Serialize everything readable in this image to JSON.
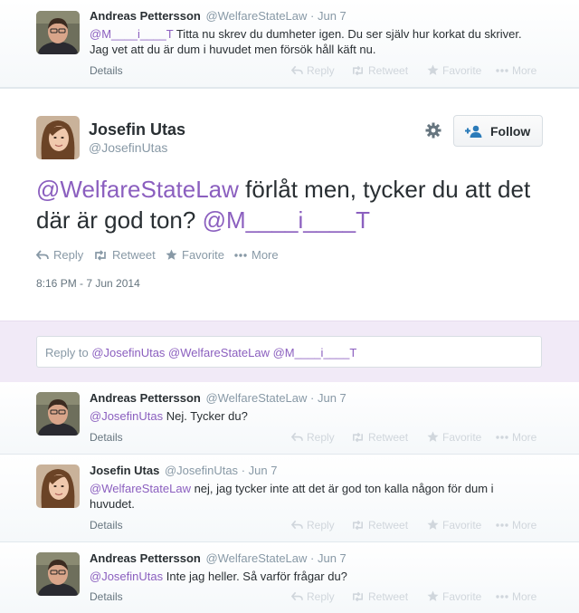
{
  "colors": {
    "mention": "#8b5fbf",
    "accent": "#2b7bb9",
    "muted": "#8899a6"
  },
  "top_tweet": {
    "name": "Andreas Pettersson",
    "handle": "@WelfareStateLaw",
    "date": "· Jun 7",
    "mention": "@M____i____T",
    "text": " Titta nu skrev du dumheter igen. Du ser själv hur korkat du skriver. Jag vet att du är dum i huvudet men försök håll käft nu.",
    "details": "Details"
  },
  "actions": {
    "reply": "Reply",
    "retweet": "Retweet",
    "favorite": "Favorite",
    "more": "More"
  },
  "main_tweet": {
    "name": "Josefin Utas",
    "handle": "@JosefinUtas",
    "follow_label": "Follow",
    "mention1": "@WelfareStateLaw",
    "text": " förlåt men, tycker du att det där är god ton? ",
    "mention2": "@M____i____T",
    "timestamp": "8:16 PM - 7 Jun 2014"
  },
  "reply_box": {
    "prefix": "Reply to ",
    "mentions": "@JosefinUtas @WelfareStateLaw @M____i____T"
  },
  "replies": [
    {
      "name": "Andreas Pettersson",
      "handle": "@WelfareStateLaw",
      "date": "· Jun 7",
      "mention": "@JosefinUtas",
      "text": " Nej. Tycker du?",
      "details": "Details"
    },
    {
      "name": "Josefin Utas",
      "handle": "@JosefinUtas",
      "date": "· Jun 7",
      "mention": "@WelfareStateLaw",
      "text": " nej, jag tycker inte att det är god ton kalla någon för dum i huvudet.",
      "details": "Details"
    },
    {
      "name": "Andreas Pettersson",
      "handle": "@WelfareStateLaw",
      "date": "· Jun 7",
      "mention": "@JosefinUtas",
      "text": " Inte jag heller. Så varför frågar du?",
      "details": "Details"
    }
  ]
}
